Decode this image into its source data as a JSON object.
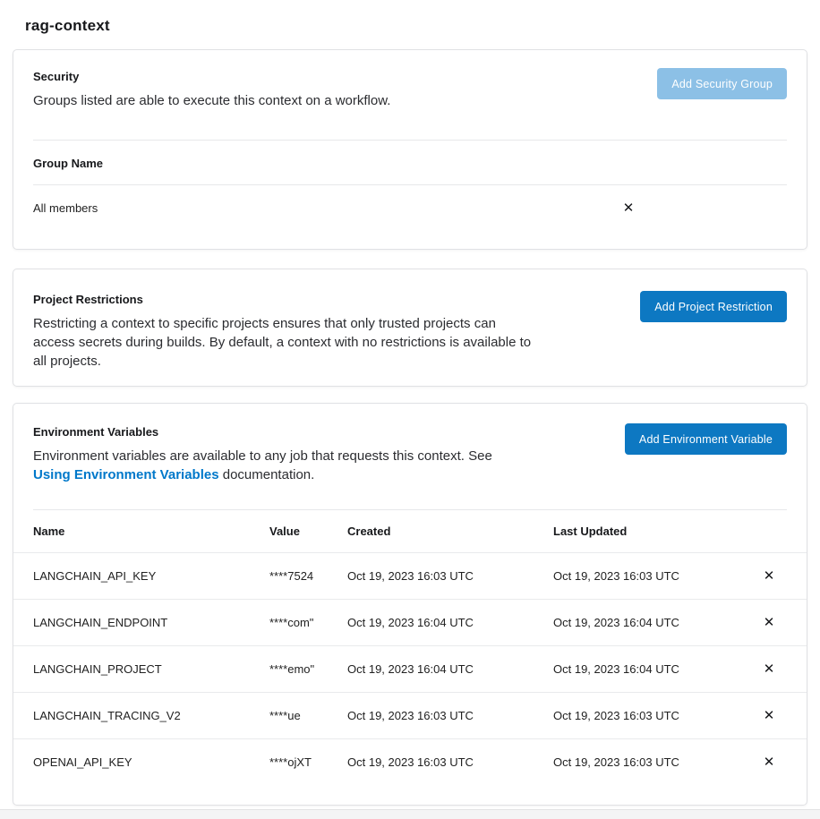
{
  "page": {
    "title": "rag-context"
  },
  "security": {
    "title": "Security",
    "description": "Groups listed are able to execute this context on a workflow.",
    "add_button": "Add Security Group",
    "group_header": "Group Name",
    "groups": [
      {
        "name": "All members"
      }
    ],
    "remove_icon": "✕"
  },
  "project_restrictions": {
    "title": "Project Restrictions",
    "description": "Restricting a context to specific projects ensures that only trusted projects can access secrets during builds. By default, a context with no restrictions is available to all projects.",
    "add_button": "Add Project Restriction"
  },
  "environment_variables": {
    "title": "Environment Variables",
    "description_prefix": "Environment variables are available to any job that requests this context. See ",
    "link_text": "Using Environment Variables",
    "description_suffix": " documentation.",
    "add_button": "Add Environment Variable",
    "table": {
      "columns": [
        "Name",
        "Value",
        "Created",
        "Last Updated"
      ],
      "remove_icon": "✕",
      "rows": [
        {
          "name": "LANGCHAIN_API_KEY",
          "value": "****7524",
          "created": "Oct 19, 2023 16:03 UTC",
          "updated": "Oct 19, 2023 16:03 UTC"
        },
        {
          "name": "LANGCHAIN_ENDPOINT",
          "value": "****com\"",
          "created": "Oct 19, 2023 16:04 UTC",
          "updated": "Oct 19, 2023 16:04 UTC"
        },
        {
          "name": "LANGCHAIN_PROJECT",
          "value": "****emo\"",
          "created": "Oct 19, 2023 16:04 UTC",
          "updated": "Oct 19, 2023 16:04 UTC"
        },
        {
          "name": "LANGCHAIN_TRACING_V2",
          "value": "****ue",
          "created": "Oct 19, 2023 16:03 UTC",
          "updated": "Oct 19, 2023 16:03 UTC"
        },
        {
          "name": "OPENAI_API_KEY",
          "value": "****ojXT",
          "created": "Oct 19, 2023 16:03 UTC",
          "updated": "Oct 19, 2023 16:03 UTC"
        }
      ]
    }
  },
  "colors": {
    "primary_button": "#0d78c2",
    "disabled_button": "#8cc0e6",
    "link": "#0078ca",
    "text": "#212121",
    "border": "#e0e1e4"
  }
}
